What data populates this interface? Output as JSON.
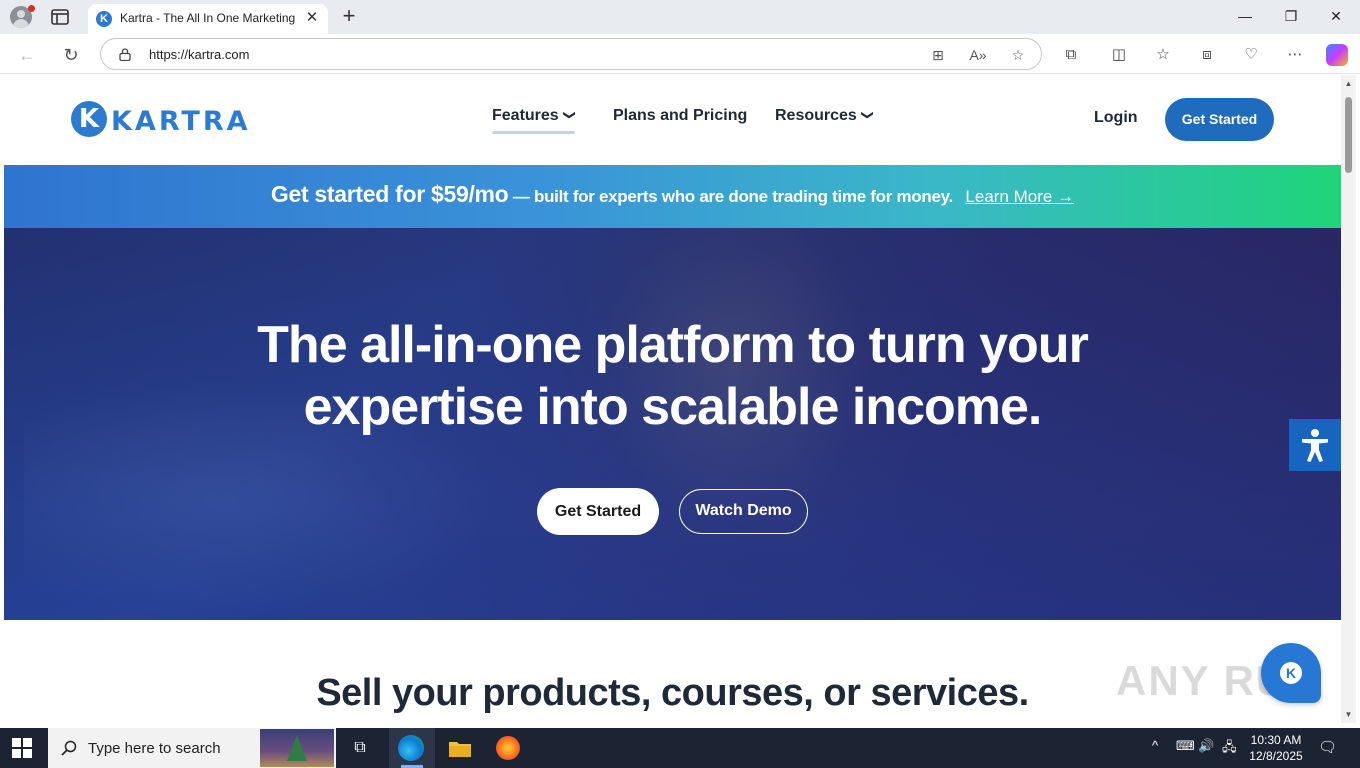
{
  "browser": {
    "tab_title": "Kartra - The All In One Marketing",
    "tab_favicon": "K",
    "url": "https://kartra.com",
    "window_controls": [
      "minimize-icon",
      "restore-icon",
      "close-icon"
    ]
  },
  "site": {
    "logo_text": "KARTRA",
    "nav": {
      "features": "Features",
      "plans": "Plans and Pricing",
      "resources": "Resources"
    },
    "login": "Login",
    "header_cta": "Get Started"
  },
  "promo": {
    "main": "Get started for $59/mo",
    "sub": "— built for experts who are done trading time for money.",
    "link": "Learn More →"
  },
  "hero": {
    "title_line1": "The all-in-one platform to turn your",
    "title_line2": "expertise into scalable income.",
    "primary_button": "Get Started",
    "secondary_button": "Watch Demo"
  },
  "section": {
    "title": "Sell your products, courses, or services."
  },
  "watermark": "ANY RUN",
  "taskbar": {
    "search_placeholder": "Type here to search",
    "time": "10:30 AM",
    "date": "12/8/2025"
  },
  "colors": {
    "brand_blue": "#2b7bd2",
    "cta_blue": "#1f6cbf",
    "promo_gradient_start": "#2f74d0",
    "promo_gradient_end": "#1fd57a",
    "hero_background": "#2a2f73"
  }
}
